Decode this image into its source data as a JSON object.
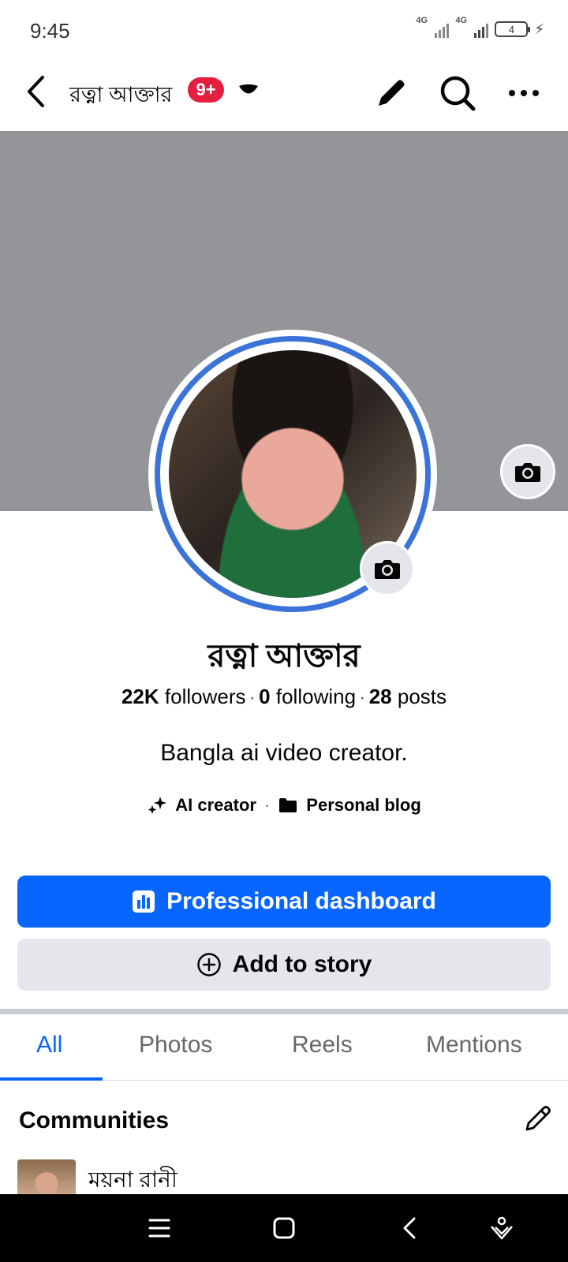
{
  "status": {
    "time": "9:45",
    "network1": "4G",
    "network2": "4G",
    "battery": "4"
  },
  "nav": {
    "title": "রত্না আক্তার",
    "badge": "9+"
  },
  "profile": {
    "name": "রত্না আক্তার",
    "followers_count": "22K",
    "followers_label": "followers",
    "following_count": "0",
    "following_label": "following",
    "posts_count": "28",
    "posts_label": "posts",
    "bio": "Bangla ai video creator.",
    "category_1": "AI creator",
    "category_2": "Personal blog"
  },
  "buttons": {
    "dashboard": "Professional dashboard",
    "add_story": "Add to story"
  },
  "tabs": [
    {
      "label": "All"
    },
    {
      "label": "Photos"
    },
    {
      "label": "Reels"
    },
    {
      "label": "Mentions"
    }
  ],
  "communities": {
    "title": "Communities",
    "first_item": "ময়না রানী"
  },
  "colors": {
    "accent": "#0866ff",
    "badge": "#e41e3f",
    "cover": "#939598"
  }
}
